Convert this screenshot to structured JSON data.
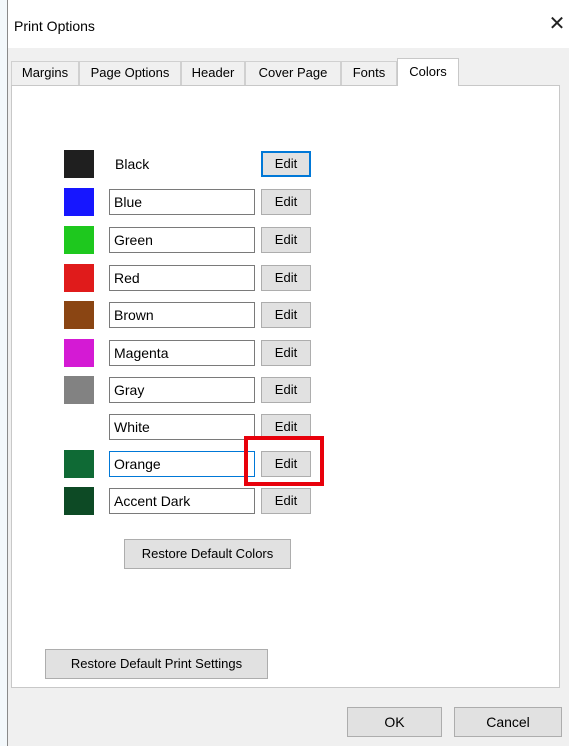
{
  "window": {
    "title": "Print Options",
    "close_glyph": "✕"
  },
  "tabs": [
    {
      "label": "Margins"
    },
    {
      "label": "Page Options"
    },
    {
      "label": "Header"
    },
    {
      "label": "Cover Page"
    },
    {
      "label": "Fonts"
    },
    {
      "label": "Colors",
      "active": true
    }
  ],
  "colors": [
    {
      "name": "Black",
      "swatch": "#1f1f1f",
      "edit_label": "Edit"
    },
    {
      "name": "Blue",
      "swatch": "#1616ff",
      "edit_label": "Edit"
    },
    {
      "name": "Green",
      "swatch": "#1ec81e",
      "edit_label": "Edit"
    },
    {
      "name": "Red",
      "swatch": "#e01b1b",
      "edit_label": "Edit"
    },
    {
      "name": "Brown",
      "swatch": "#8a4513",
      "edit_label": "Edit"
    },
    {
      "name": "Magenta",
      "swatch": "#d41ad4",
      "edit_label": "Edit"
    },
    {
      "name": "Gray",
      "swatch": "#828282",
      "edit_label": "Edit"
    },
    {
      "name": "White",
      "swatch": "#ffffff",
      "edit_label": "Edit"
    },
    {
      "name": "Orange",
      "swatch": "#0f6a35",
      "edit_label": "Edit"
    },
    {
      "name": "Accent Dark",
      "swatch": "#0d4a25",
      "edit_label": "Edit"
    }
  ],
  "restore_colors_label": "Restore Default Colors",
  "restore_print_label": "Restore Default Print Settings",
  "footer": {
    "ok_label": "OK",
    "cancel_label": "Cancel"
  },
  "highlight_color": "#e8000b",
  "accent_color": "#0078d7"
}
